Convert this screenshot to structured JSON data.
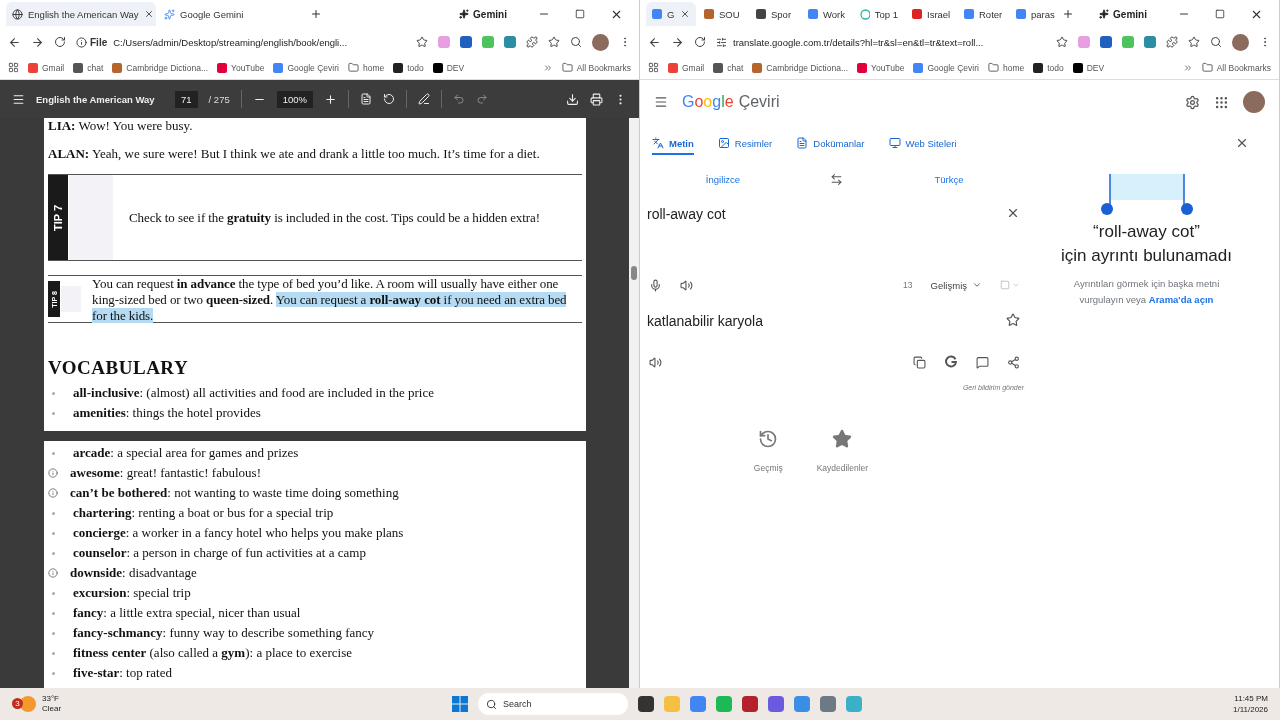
{
  "left_browser": {
    "tabs": [
      {
        "title": "English the American Way",
        "selected": true
      },
      {
        "title": "Google Gemini",
        "selected": false
      }
    ],
    "gemini_label": "Gemini",
    "site_label": "File",
    "address": "C:/Users/admin/Desktop/streaming/english/book/engli...",
    "bookmarks": [
      "Gmail",
      "chat",
      "Cambridge Dictiona...",
      "YouTube",
      "Google Çeviri",
      "home",
      "todo",
      "DEV"
    ],
    "all_bookmarks": "All Bookmarks"
  },
  "pdf": {
    "title": "English the American Way",
    "page": "71",
    "total": "/ 275",
    "zoom": "100%",
    "pages": [
      {
        "blocks": [
          {
            "kind": "dialogue",
            "speaker": "LIA:",
            "text": "Wow! You were busy."
          },
          {
            "kind": "dialogue",
            "speaker": "ALAN:",
            "text": "Yeah, we sure were! But I think we ate and drank a little too much. It’s time for a diet."
          },
          {
            "kind": "tip_large",
            "label": "TIP 7",
            "text": "Check to see if the **gratuity** is included in the cost. Tips could be a hidden extra!"
          },
          {
            "kind": "tip_small",
            "label": "TIP 8",
            "text": "You can request **in advance** the type of bed you’d like. A room will usually have either one king-sized bed or two **queen-sized**.",
            "selected_text": "You can request a **roll-away cot** if you need an extra bed for the kids."
          },
          {
            "kind": "heading",
            "text": "VOCABULARY"
          },
          {
            "kind": "vocab_bullet",
            "text": "**all-inclusive**: (almost) all activities and food are included in the price"
          },
          {
            "kind": "vocab_bullet",
            "text": "**amenities**: things the hotel provides"
          }
        ]
      },
      {
        "blocks": [
          {
            "kind": "vocab_bullet",
            "text": "**arcade**: a special area for games and prizes"
          },
          {
            "kind": "vocab_info",
            "text": "**awesome**: great! fantastic! fabulous!"
          },
          {
            "kind": "vocab_info",
            "text": "**can’t be bothered**: not wanting to waste time doing something"
          },
          {
            "kind": "vocab_bullet",
            "text": "**chartering**: renting a boat or bus for a special trip"
          },
          {
            "kind": "vocab_bullet",
            "text": "**concierge**: a worker in a fancy hotel who helps you make plans"
          },
          {
            "kind": "vocab_bullet",
            "text": "**counselor**: a person in charge of fun activities at a camp"
          },
          {
            "kind": "vocab_info",
            "text": "**downside**: disadvantage"
          },
          {
            "kind": "vocab_bullet",
            "text": "**excursion**: special trip"
          },
          {
            "kind": "vocab_bullet",
            "text": "**fancy**: a little extra special, nicer than usual"
          },
          {
            "kind": "vocab_bullet",
            "text": "**fancy-schmancy**: funny way to describe something fancy"
          },
          {
            "kind": "vocab_bullet",
            "text": "**fitness center** (also called a **gym**): a place to exercise"
          },
          {
            "kind": "vocab_bullet",
            "text": "**five-star**: top rated"
          }
        ]
      }
    ]
  },
  "right_browser": {
    "tabs": [
      {
        "title": "G",
        "selected": true
      },
      {
        "title": "SOU",
        "selected": false
      },
      {
        "title": "Spor",
        "selected": false
      },
      {
        "title": "Work",
        "selected": false
      },
      {
        "title": "Top 1",
        "selected": false
      },
      {
        "title": "Israel",
        "selected": false
      },
      {
        "title": "Roter",
        "selected": false
      },
      {
        "title": "paras",
        "selected": false
      }
    ],
    "gemini_label": "Gemini",
    "address": "translate.google.com.tr/details?hl=tr&sl=en&tl=tr&text=roll...",
    "bookmarks": [
      "Gmail",
      "chat",
      "Cambridge Dictiona...",
      "YouTube",
      "Google Çeviri",
      "home",
      "todo",
      "DEV"
    ],
    "all_bookmarks": "All Bookmarks"
  },
  "translate": {
    "logo_word": "Google",
    "logo_suffix": "Çeviri",
    "modes": [
      {
        "label": "Metin",
        "selected": true
      },
      {
        "label": "Resimler",
        "selected": false
      },
      {
        "label": "Dokümanlar",
        "selected": false
      },
      {
        "label": "Web Siteleri",
        "selected": false
      }
    ],
    "source_lang": "İngilizce",
    "target_lang": "Türkçe",
    "input": "roll-away cot",
    "char_count": "13",
    "model": "Gelişmiş",
    "output": "katlanabilir karyola",
    "feedback": "Geri bildirim gönder",
    "history": "Geçmiş",
    "saved": "Kaydedilenler",
    "details_title": [
      "“roll-away cot”",
      "için ayrıntı bulunamadı"
    ],
    "details_text": "Ayrıntıları görmek için başka metni vurgulayın veya",
    "details_link": "Arama'da açın"
  },
  "taskbar": {
    "weather_badge": "3",
    "temperature": "33°F",
    "condition": "Clear",
    "search": "Search",
    "time": "11:45 PM",
    "date": "1/11/2026"
  }
}
